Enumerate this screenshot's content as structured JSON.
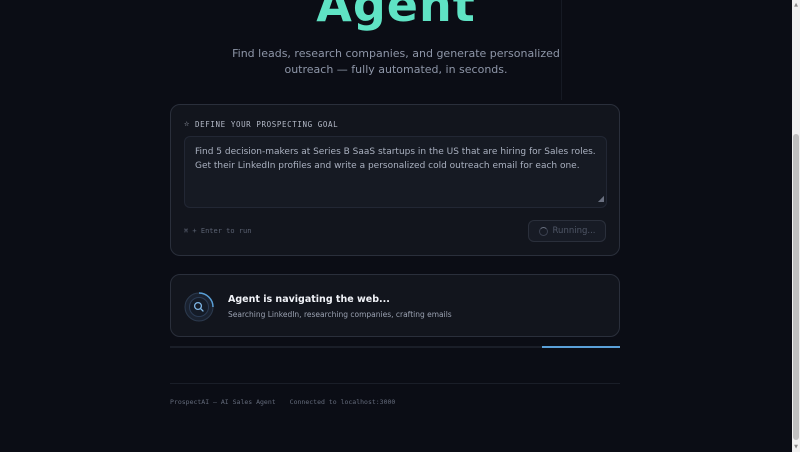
{
  "hero": {
    "title": "Agent",
    "subtitle_line1": "Find leads, research companies, and generate personalized",
    "subtitle_line2": "outreach — fully automated, in seconds."
  },
  "goal": {
    "label": "DEFINE YOUR PROSPECTING GOAL",
    "icon": "star-icon",
    "text": "Find 5 decision-makers at Series B SaaS startups in the US that are hiring for Sales roles. Get their LinkedIn profiles and write a personalized cold outreach email for each one.",
    "hint": "⌘ + Enter to run",
    "run_label": "Running..."
  },
  "status": {
    "title": "Agent is navigating the web...",
    "subtitle": "Searching LinkedIn, researching companies, crafting emails",
    "icon": "search-icon"
  },
  "footer": {
    "left": "ProspectAI — AI Sales Agent",
    "right": "Connected to localhost:3000"
  },
  "colors": {
    "accent": "#5fe3c4",
    "progress": "#5aa0d8",
    "background": "#0b0d15"
  }
}
